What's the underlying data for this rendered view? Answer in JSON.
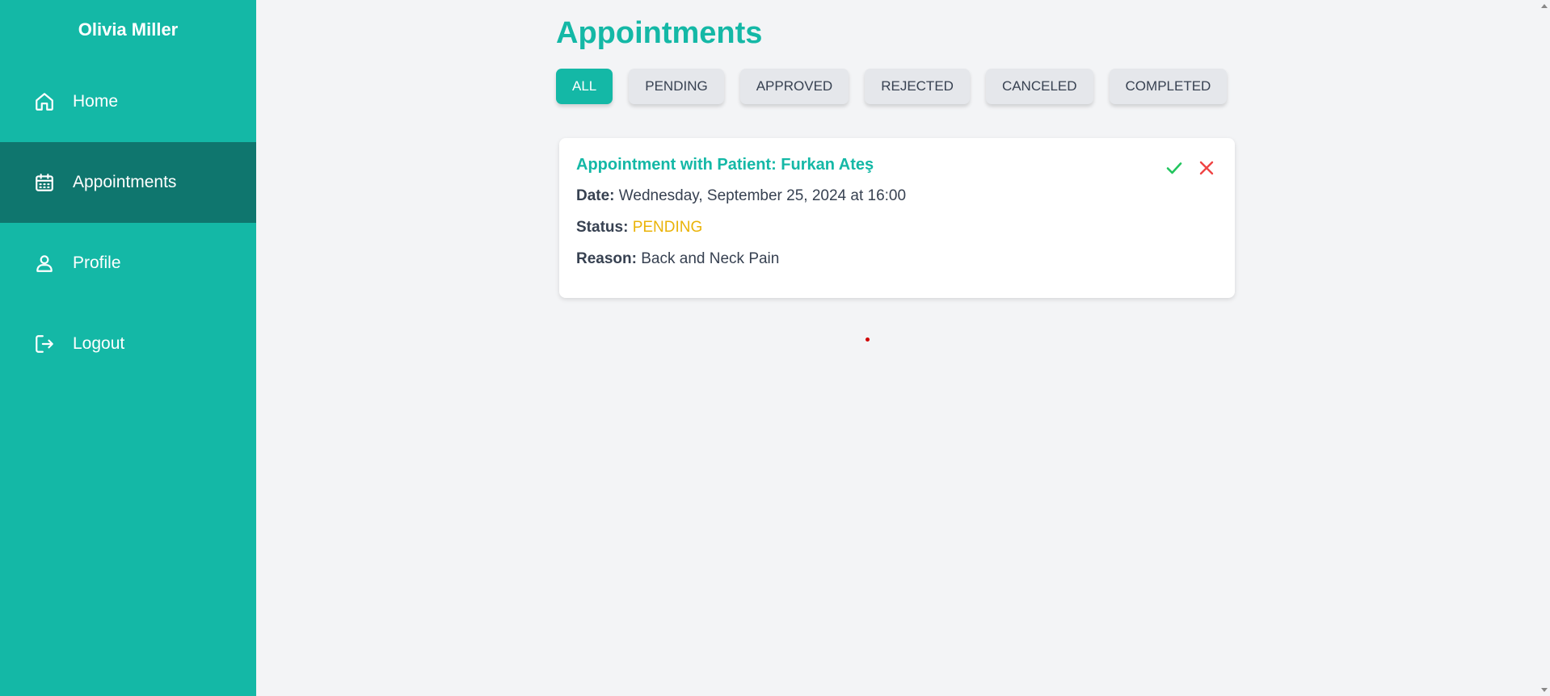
{
  "sidebar": {
    "user_name": "Olivia Miller",
    "items": [
      {
        "label": "Home",
        "icon": "home-icon"
      },
      {
        "label": "Appointments",
        "icon": "calendar-icon",
        "active": true
      },
      {
        "label": "Profile",
        "icon": "user-icon"
      },
      {
        "label": "Logout",
        "icon": "logout-icon"
      }
    ]
  },
  "page": {
    "title": "Appointments"
  },
  "filters": [
    "ALL",
    "PENDING",
    "APPROVED",
    "REJECTED",
    "CANCELED",
    "COMPLETED"
  ],
  "active_filter": "ALL",
  "appointment": {
    "title": "Appointment with Patient: Furkan Ateş",
    "date_label": "Date:",
    "date_value": "Wednesday, September 25, 2024 at 16:00",
    "status_label": "Status:",
    "status_value": "PENDING",
    "reason_label": "Reason:",
    "reason_value": "Back and Neck Pain",
    "approve_icon": "check-icon",
    "reject_icon": "close-icon"
  },
  "colors": {
    "accent": "#14b8a6",
    "sidebar_active": "#0f766e",
    "status_pending": "#eab308",
    "approve": "#22c55e",
    "reject": "#ef4444"
  }
}
